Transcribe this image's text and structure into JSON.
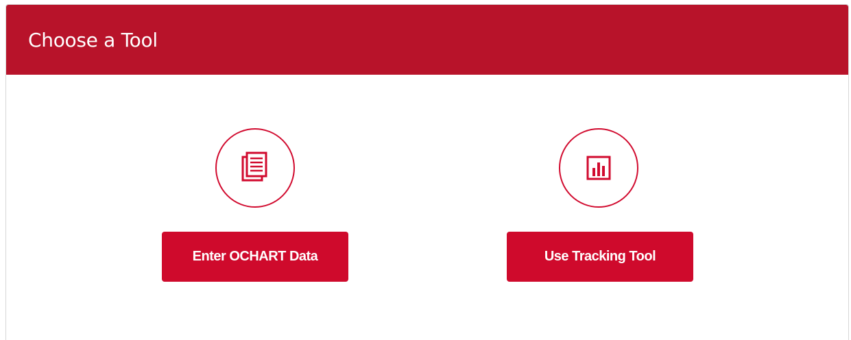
{
  "panel": {
    "title": "Choose a Tool"
  },
  "tools": [
    {
      "icon": "document-icon",
      "button_label": "Enter OCHART Data"
    },
    {
      "icon": "bar-chart-icon",
      "button_label": "Use Tracking Tool"
    }
  ],
  "colors": {
    "header_bg": "#b8132a",
    "accent": "#cf0a2c",
    "icon_stroke": "#d10a2e",
    "border": "#d6d6d6"
  }
}
